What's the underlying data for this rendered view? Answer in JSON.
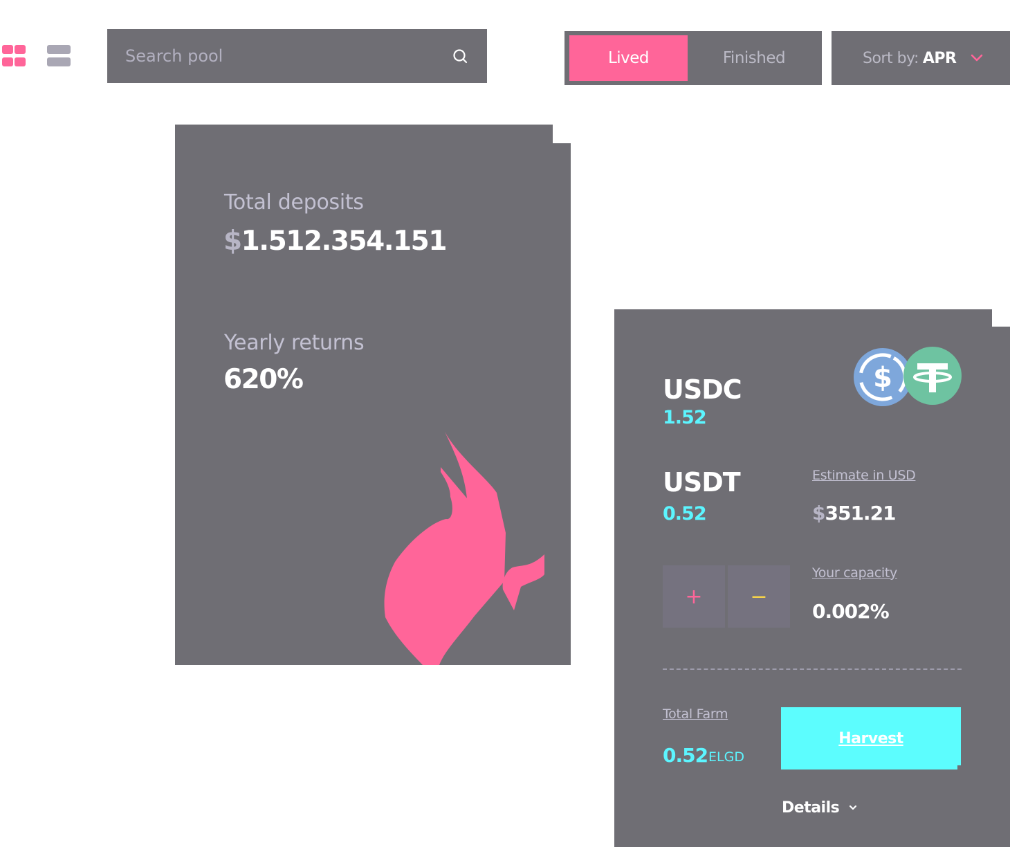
{
  "colors": {
    "accent_pink": "#ff6599",
    "accent_cyan": "#5cf5ff",
    "panel_gray": "#6f6e74",
    "muted_text": "#c3c1d2"
  },
  "view_toggle": {
    "grid_icon": "grid-icon",
    "list_icon": "list-icon",
    "active": "grid"
  },
  "search": {
    "placeholder": "Search pool",
    "value": "",
    "icon": "search-icon"
  },
  "status_tabs": [
    {
      "label": "Lived",
      "active": true
    },
    {
      "label": "Finished",
      "active": false
    }
  ],
  "sort": {
    "prefix": "Sort by:",
    "value": "APR",
    "icon": "chevron-down-icon"
  },
  "stats": {
    "total_deposits_label": "Total deposits",
    "total_deposits_currency": "$",
    "total_deposits_value": "1.512.354.151",
    "yearly_returns_label": "Yearly returns",
    "yearly_returns_value": "620%",
    "illustration": "flame-icon"
  },
  "pool": {
    "token_a": {
      "symbol": "USDC",
      "amount": "1.52",
      "icon": "usdc-coin-icon"
    },
    "token_b": {
      "symbol": "USDT",
      "amount": "0.52",
      "icon": "usdt-coin-icon"
    },
    "estimate_label": "Estimate in USD",
    "estimate_currency": "$",
    "estimate_value": "351.21",
    "capacity_label": "Your capacity",
    "capacity_value": "0.002%",
    "add_symbol": "+",
    "remove_symbol": "−",
    "total_farm_label": "Total Farm",
    "total_farm_value": "0.52",
    "total_farm_unit": "ELGD",
    "harvest_label": "Harvest",
    "details_label": "Details"
  }
}
